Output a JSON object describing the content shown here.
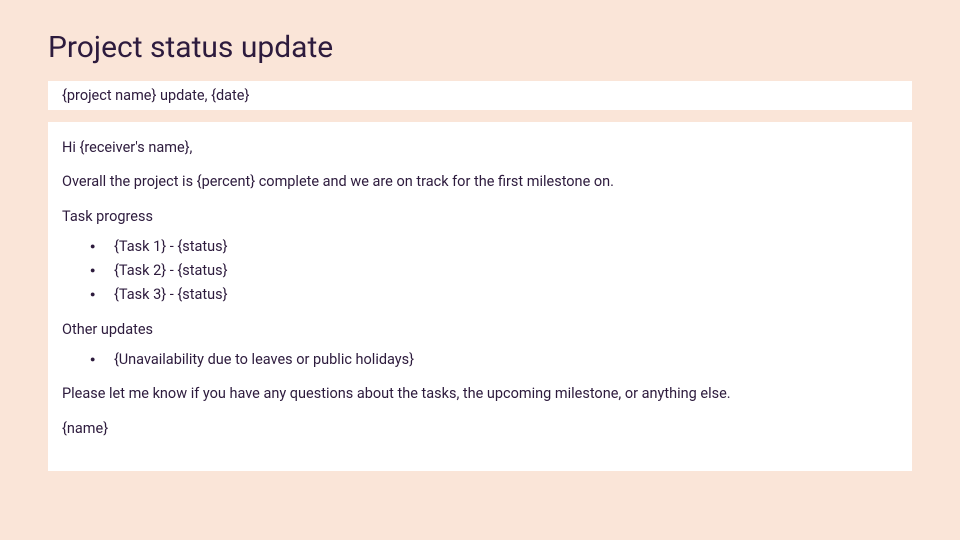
{
  "title": "Project status update",
  "subject": "{project name} update, {date}",
  "greeting": "Hi {receiver's name},",
  "overview": "Overall the project is {percent} complete and we are on track for the first milestone on.",
  "task_progress_label": "Task progress",
  "tasks": [
    "{Task 1} - {status}",
    "{Task 2} - {status}",
    "{Task 3} - {status}"
  ],
  "other_updates_label": "Other updates",
  "other_updates": [
    "{Unavailability due to leaves or public holidays}"
  ],
  "closing": "Please let me know if you have any questions about the tasks, the upcoming milestone, or anything else.",
  "signature": "{name}"
}
